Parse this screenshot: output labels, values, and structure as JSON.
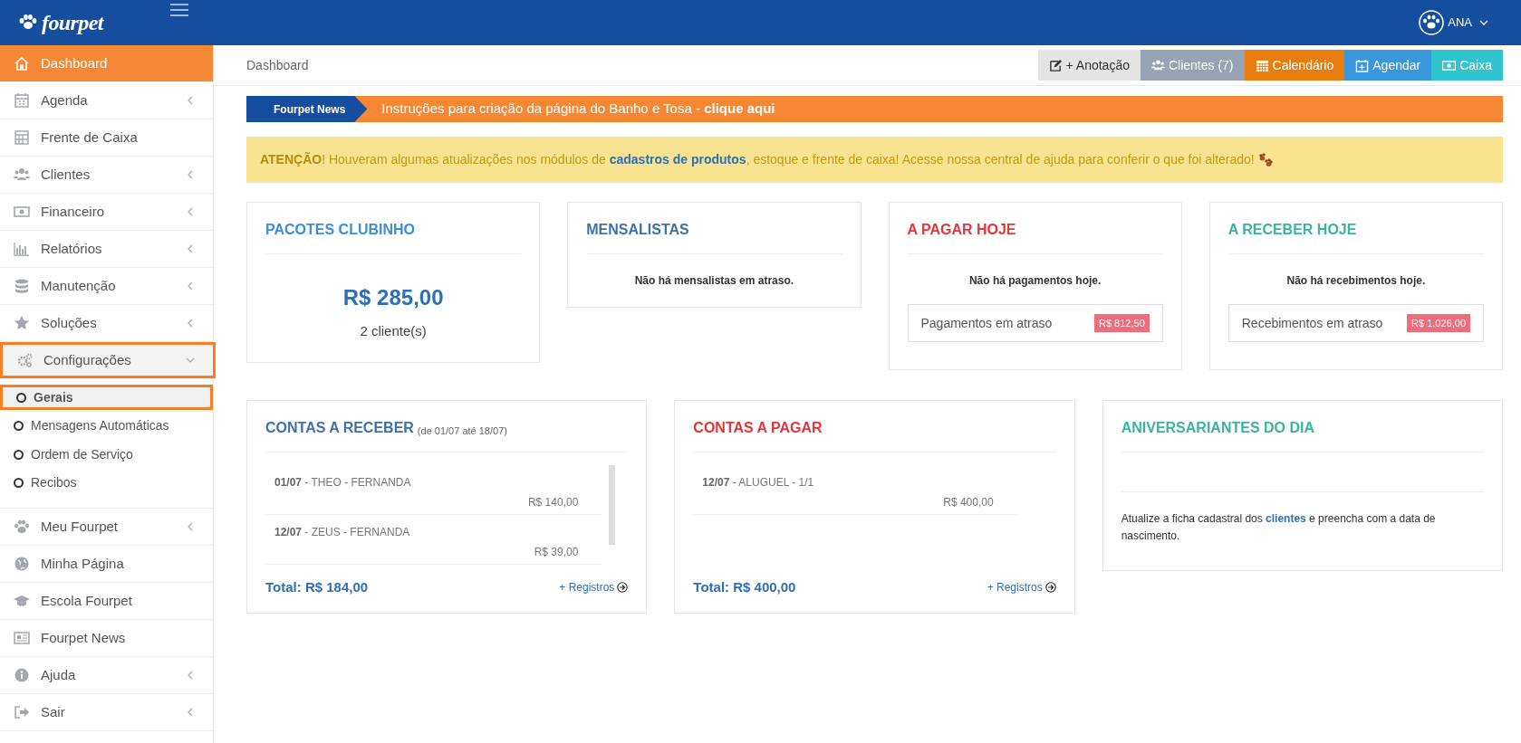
{
  "topbar": {
    "logo": "fourpet",
    "user": "ANA"
  },
  "sidebar": {
    "items": [
      {
        "label": "Dashboard",
        "selected": true,
        "caret": false,
        "outlined": false
      },
      {
        "label": "Agenda",
        "selected": false,
        "caret": true,
        "outlined": false
      },
      {
        "label": "Frente de Caixa",
        "selected": false,
        "caret": false,
        "outlined": false
      },
      {
        "label": "Clientes",
        "selected": false,
        "caret": true,
        "outlined": false
      },
      {
        "label": "Financeiro",
        "selected": false,
        "caret": true,
        "outlined": false
      },
      {
        "label": "Relatórios",
        "selected": false,
        "caret": true,
        "outlined": false
      },
      {
        "label": "Manutenção",
        "selected": false,
        "caret": true,
        "outlined": false
      },
      {
        "label": "Soluções",
        "selected": false,
        "caret": true,
        "outlined": false
      },
      {
        "label": "Configurações",
        "selected": false,
        "caret": true,
        "outlined": true,
        "expanded": true,
        "children": [
          {
            "label": "Gerais",
            "selected": true,
            "outlined": true
          },
          {
            "label": "Mensagens Automáticas",
            "selected": false,
            "outlined": false
          },
          {
            "label": "Ordem de Serviço",
            "selected": false,
            "outlined": false
          },
          {
            "label": "Recibos",
            "selected": false,
            "outlined": false
          }
        ]
      },
      {
        "label": "Meu Fourpet",
        "selected": false,
        "caret": true,
        "outlined": false
      },
      {
        "label": "Minha Página",
        "selected": false,
        "caret": false,
        "outlined": false
      },
      {
        "label": "Escola Fourpet",
        "selected": false,
        "caret": false,
        "outlined": false
      },
      {
        "label": "Fourpet News",
        "selected": false,
        "caret": false,
        "outlined": false
      },
      {
        "label": "Ajuda",
        "selected": false,
        "caret": true,
        "outlined": false
      },
      {
        "label": "Sair",
        "selected": false,
        "caret": true,
        "outlined": false
      }
    ]
  },
  "breadcrumb": "Dashboard",
  "actions": [
    {
      "label": "+ Anotação",
      "color": "#e4e4e4"
    },
    {
      "label": "Clientes (7)",
      "color": "#97a3b5"
    },
    {
      "label": "Calendário",
      "color": "#e87c0d"
    },
    {
      "label": "Agendar",
      "color": "#3b97dd"
    },
    {
      "label": "Caixa",
      "color": "#30c4cf"
    }
  ],
  "news": {
    "tag": "Fourpet News",
    "text": "Instruções para criação da página do Banho e Tosa - **clique aqui**"
  },
  "alert": "**ATENÇÃO**! Houveram algumas atualizações nos módulos de **cadastros de produtos**, estoque e frente de caixa! Acesse nossa central de ajuda para conferir o que foi alterado!",
  "summary_cards": [
    {
      "title": "PACOTES CLUBINHO",
      "color": "#3a8fd9",
      "kind": "amount",
      "value": "R$ 285,00",
      "clients": "2 cliente(s)"
    },
    {
      "title": "MENSALISTAS",
      "color": "#3d72a8",
      "kind": "message",
      "message": "Não há mensalistas em atraso."
    },
    {
      "title": "A PAGAR HOJE",
      "color": "#e4353b",
      "kind": "overdue",
      "message": "Não há pagamentos hoje.",
      "overdue_label": "Pagamentos em atraso",
      "overdue_value": "R$ 812,50"
    },
    {
      "title": "A RECEBER HOJE",
      "color": "#3bb3a0",
      "kind": "overdue",
      "message": "Não há recebimentos hoje.",
      "overdue_label": "Recebimentos em atraso",
      "overdue_value": "R$ 1.026,00"
    }
  ],
  "list_cards": [
    {
      "title": "CONTAS A RECEBER",
      "subtitle": "(de 01/07 até 18/07)",
      "color": "#3d72a8",
      "kind": "entries",
      "entries": [
        {
          "date": "01/07",
          "text": " - THEO - FERNANDA",
          "amount": "R$ 140,00"
        },
        {
          "date": "12/07",
          "text": " - ZEUS - FERNANDA",
          "amount": "R$ 39,00"
        }
      ],
      "total": "Total: R$ 184,00",
      "link": "+ Registros"
    },
    {
      "title": "CONTAS A PAGAR",
      "color": "#e4353b",
      "kind": "entries",
      "entries": [
        {
          "date": "12/07",
          "text": " - ALUGUEL - 1/1",
          "amount": "R$ 400,00"
        }
      ],
      "total": "Total: R$ 400,00",
      "link": "+ Registros"
    },
    {
      "title": "ANIVERSARIANTES DO DIA",
      "color": "#3bb3a0",
      "kind": "note",
      "note": "Atualize a ficha cadastral dos **clientes** e preencha com a data de nascimento."
    }
  ]
}
